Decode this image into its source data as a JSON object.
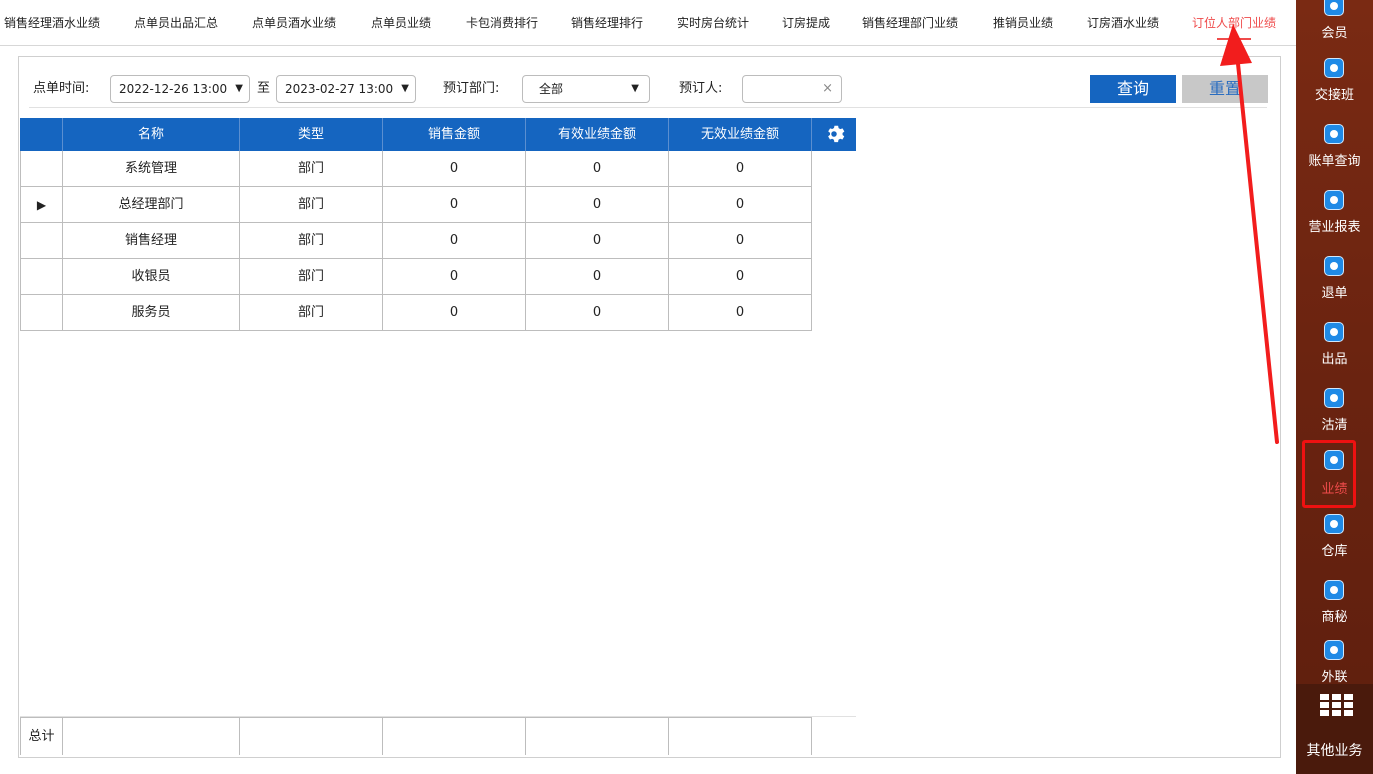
{
  "tabs": [
    {
      "label": "销售经理酒水业绩"
    },
    {
      "label": "点单员出品汇总"
    },
    {
      "label": "点单员酒水业绩"
    },
    {
      "label": "点单员业绩"
    },
    {
      "label": "卡包消费排行"
    },
    {
      "label": "销售经理排行"
    },
    {
      "label": "实时房台统计"
    },
    {
      "label": "订房提成"
    },
    {
      "label": "销售经理部门业绩"
    },
    {
      "label": "推销员业绩"
    },
    {
      "label": "订房酒水业绩"
    },
    {
      "label": "订位人部门业绩",
      "active": true
    }
  ],
  "filters": {
    "time_label": "点单时间:",
    "start": "2022-12-26 13:00",
    "to_label": "至",
    "end": "2023-02-27 13:00",
    "dept_label": "预订部门:",
    "dept_value": "全部",
    "booker_label": "预订人:",
    "booker_value": "",
    "clear_symbol": "×"
  },
  "buttons": {
    "query": "查询",
    "reset": "重置"
  },
  "table": {
    "columns": [
      "名称",
      "类型",
      "销售金额",
      "有效业绩金额",
      "无效业绩金额"
    ],
    "rows": [
      {
        "name": "系统管理",
        "type": "部门",
        "sales": "0",
        "valid": "0",
        "invalid": "0",
        "selected": false
      },
      {
        "name": "总经理部门",
        "type": "部门",
        "sales": "0",
        "valid": "0",
        "invalid": "0",
        "selected": true
      },
      {
        "name": "销售经理",
        "type": "部门",
        "sales": "0",
        "valid": "0",
        "invalid": "0",
        "selected": false
      },
      {
        "name": "收银员",
        "type": "部门",
        "sales": "0",
        "valid": "0",
        "invalid": "0",
        "selected": false
      },
      {
        "name": "服务员",
        "type": "部门",
        "sales": "0",
        "valid": "0",
        "invalid": "0",
        "selected": false
      }
    ],
    "selected_marker": "▶",
    "total_label": "总计"
  },
  "sidebar": {
    "items": [
      {
        "label": "会员",
        "icon": "member-icon"
      },
      {
        "label": "交接班",
        "icon": "shift-icon"
      },
      {
        "label": "账单查询",
        "icon": "bill-icon"
      },
      {
        "label": "营业报表",
        "icon": "report-icon"
      },
      {
        "label": "退单",
        "icon": "refund-icon"
      },
      {
        "label": "出品",
        "icon": "product-icon"
      },
      {
        "label": "沽清",
        "icon": "soldout-icon"
      },
      {
        "label": "业绩",
        "icon": "performance-icon",
        "active": true
      },
      {
        "label": "仓库",
        "icon": "warehouse-icon"
      },
      {
        "label": "商秘",
        "icon": "secretary-icon"
      },
      {
        "label": "外联",
        "icon": "outreach-icon"
      }
    ],
    "more_label": "其他业务"
  },
  "colors": {
    "accent": "#1565c0",
    "active_tab": "#ef4b4b",
    "sidebar": "#6a2310",
    "highlight": "#e11111"
  }
}
